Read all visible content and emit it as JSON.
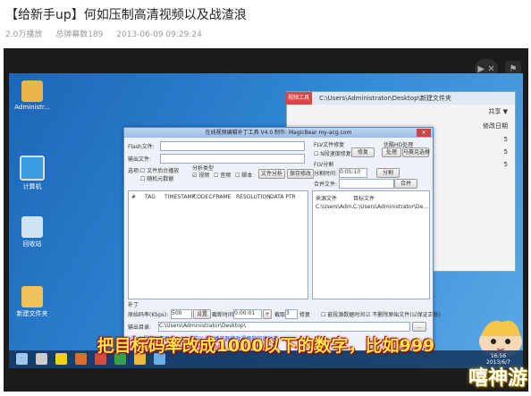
{
  "page": {
    "title": "【给新手up】何如压制高清视频以及战渣浪",
    "plays": "2.0万播放",
    "danmaku": "总弹幕数189",
    "date": "2013-06-09 09:29:24"
  },
  "player": {
    "watch_label": "▶ ✕",
    "report_label": "⚑"
  },
  "desktop": {
    "icons": [
      {
        "label": "Administr..."
      },
      {
        "label": "计算机"
      },
      {
        "label": "回收站"
      },
      {
        "label": "新建文件夹"
      }
    ],
    "explorer": {
      "tag": "视频工具",
      "path": "C:\\Users\\Administrator\\Desktop\\新建文件夹",
      "rows": [
        "共享 ▼",
        "修改日期",
        "5",
        "5",
        "5"
      ]
    }
  },
  "app": {
    "window_title": "在线视频编辑补丁工具 V4.0  制作: MagicBear  my-acg.com",
    "flash_file_label": "Flash文件:",
    "output_file_label": "输出文件:",
    "options_label": "选项:",
    "opt1": "文件后台播放",
    "opt2": "随机元数据",
    "analyze_group": "分析类型",
    "analyze_opt1": "视频",
    "analyze_opt2": "音频",
    "analyze_opt3": "脚本",
    "file_analyze_btn": "文件分析",
    "keep_btn": "保存修改",
    "flv_fix_group": "FLV文件修复",
    "flv_fix_opt": "N段速度修复",
    "fix_btn": "修复",
    "hd_group": "优酷HD处理",
    "hd_btn1": "处理",
    "hd_btn2": "马赛克选框",
    "flv_split_group": "FLV分割",
    "split_time_label": "分割时间:",
    "split_time_value": "0:05:10",
    "split_btn": "分割",
    "merge_label": "合并文件:",
    "merge_btn": "合并",
    "grid_headers": [
      "#",
      "TAG",
      "TIMESTAMP",
      "CODEC",
      "FRAME",
      "RESOLUTION",
      "DATA PTR"
    ],
    "side_headers": [
      "来源文件",
      "目标文件"
    ],
    "side_row": [
      "C:\\Users\\Adm...",
      "C:\\Users\\Administrator\\De..."
    ],
    "patch_label": "补丁",
    "bitrate_label": "原始码率(Kbps):",
    "bitrate_value": "500",
    "settings_btn": "设置",
    "start_label": "截断时间:",
    "start_value": "0:00:01",
    "plus": "+",
    "end_label": "截取",
    "end_value": "3",
    "fix_label": "修复",
    "checkbox1": "嵌段源数据时间",
    "checkbox2": "不删除原始文件(以保证正版)",
    "output_dir_label": "输出目录:",
    "output_dir_value": "C:\\Users\\Administrator\\Desktop\\",
    "browse_btn": "...",
    "note1": "*注: N段前对于Flash 10.3或以上的播放器修改视频的加速功能",
    "note2": "*提交文件类型: MP4 / FLV / H.264 MP4"
  },
  "taskbar": {
    "clock_time": "16:56",
    "clock_date": "2013/6/7"
  },
  "subtitle": "把目标码率改成1000以下的数字，比如999",
  "watermark": "嘻神游"
}
